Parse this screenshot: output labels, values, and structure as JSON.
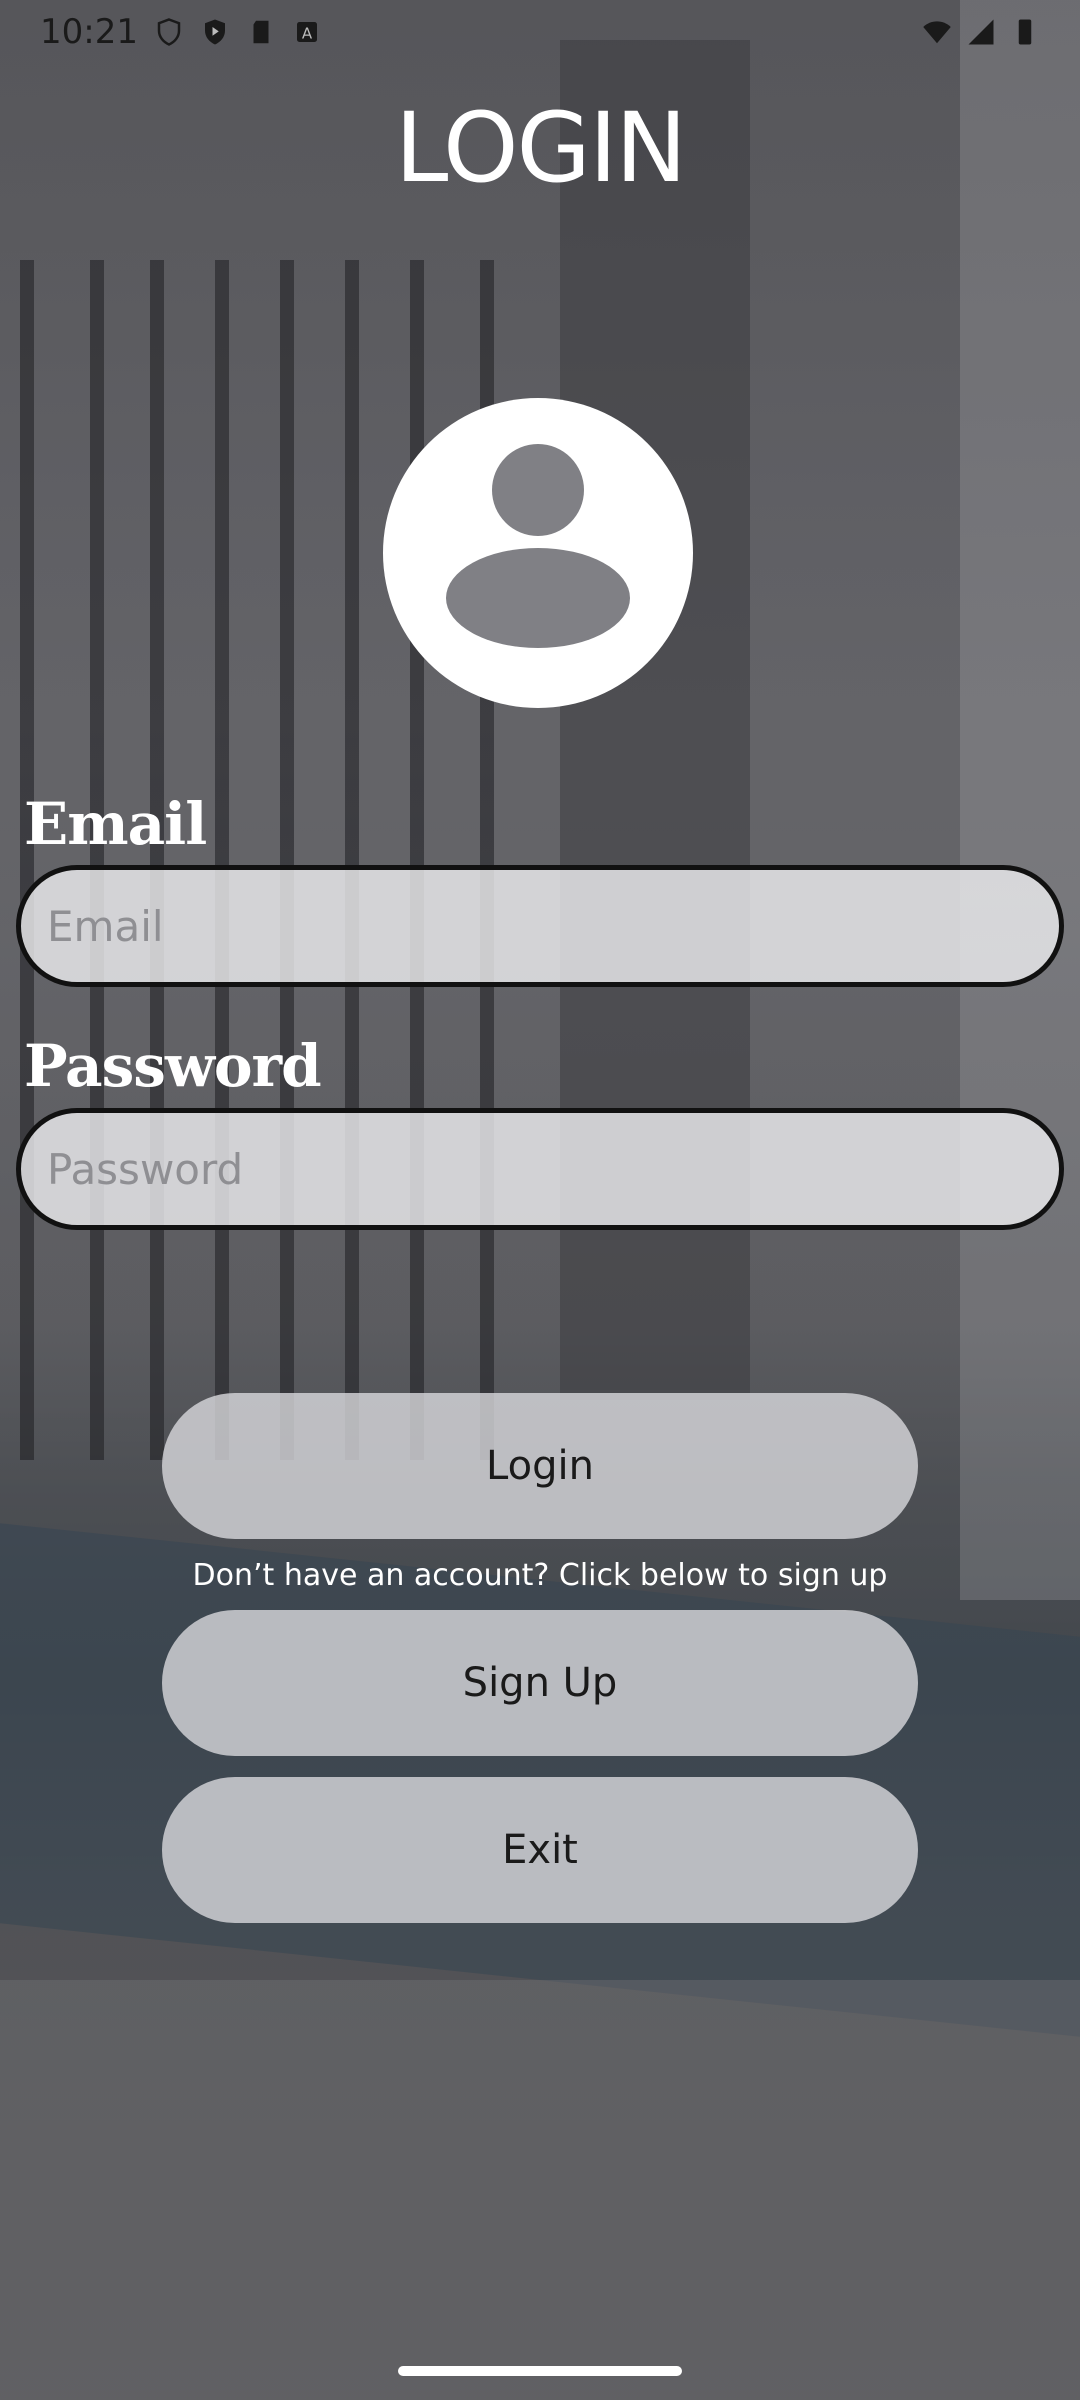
{
  "status_bar": {
    "time": "10:21",
    "left_icons": [
      "shield-icon",
      "play-protect-icon",
      "sd-card-icon",
      "keyboard-a-icon"
    ],
    "right_icons": [
      "wifi-icon",
      "signal-icon",
      "battery-icon"
    ]
  },
  "title": "LOGIN",
  "avatar_icon": "account-circle-icon",
  "email": {
    "label": "Email",
    "placeholder": "Email",
    "value": ""
  },
  "password": {
    "label": "Password",
    "placeholder": "Password",
    "value": ""
  },
  "buttons": {
    "login": "Login",
    "signup": "Sign Up",
    "exit": "Exit"
  },
  "signup_hint": "Don’t have an account? Click below to sign up",
  "colors": {
    "title_text": "#ffffff",
    "input_border": "#111111",
    "button_bg": "#dcdce0"
  }
}
